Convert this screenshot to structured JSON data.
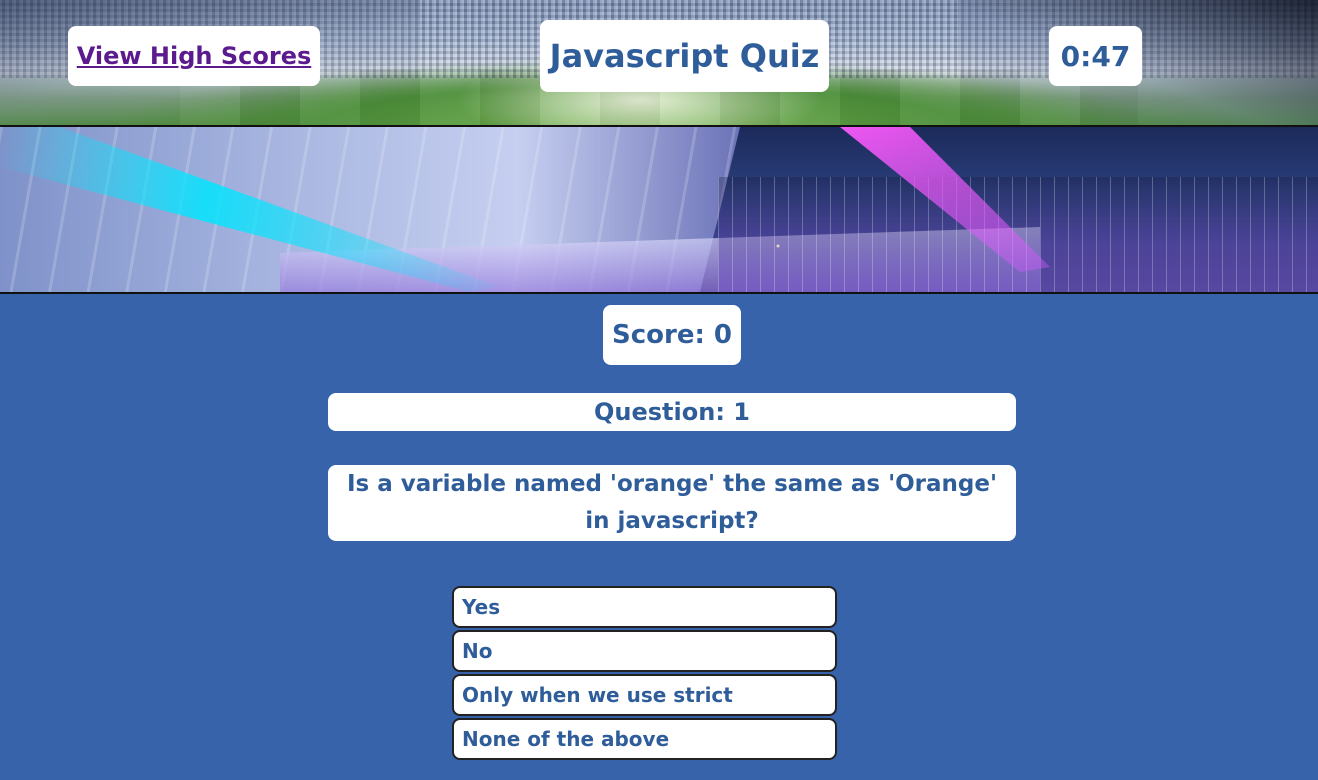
{
  "header": {
    "high_scores_link": "View High Scores",
    "title": "Javascript Quiz",
    "timer": "0:47"
  },
  "quiz": {
    "score_label": "Score: 0",
    "question_number_label": "Question: 1",
    "question_text": "Is a variable named 'orange' the same as 'Orange' in javascript?",
    "answers": [
      "Yes",
      "No",
      "Only when we use strict",
      "None of the above"
    ]
  },
  "colors": {
    "background": "#3663aa",
    "text": "#2f5d9a",
    "link": "#5b1a8e",
    "box": "#ffffff"
  }
}
